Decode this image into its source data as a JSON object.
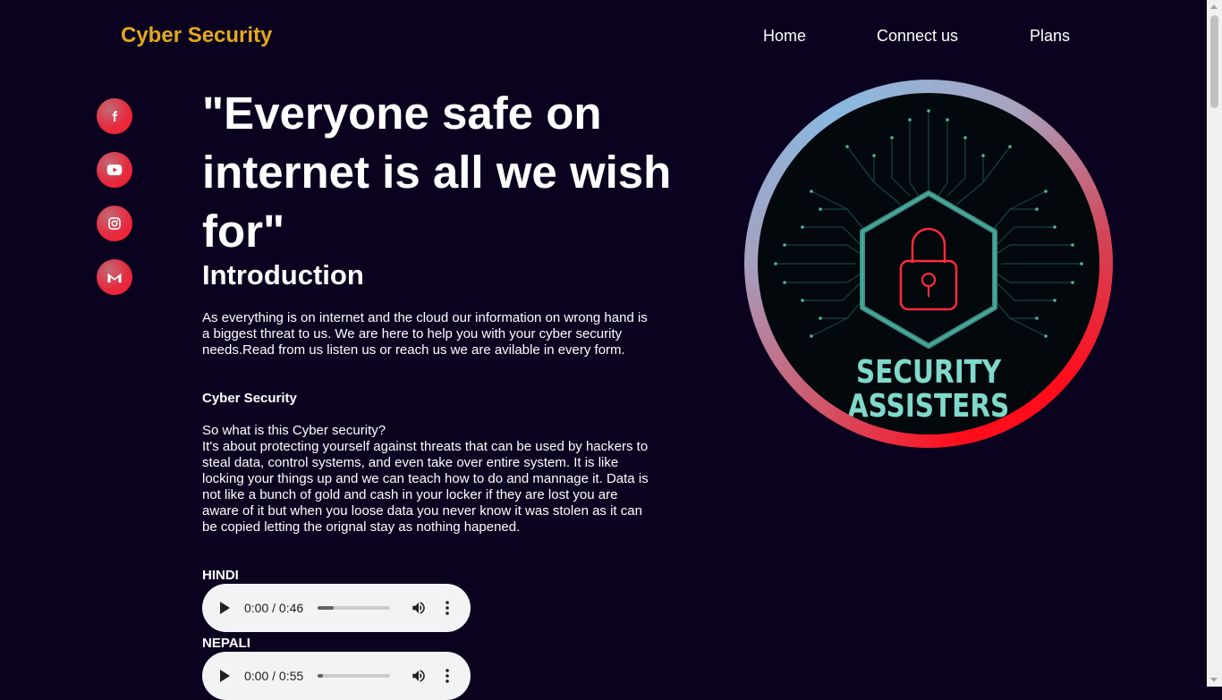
{
  "header": {
    "brand": "Cyber Security",
    "nav": [
      "Home",
      "Connect us",
      "Plans"
    ]
  },
  "social": [
    {
      "icon": "facebook-icon"
    },
    {
      "icon": "youtube-icon"
    },
    {
      "icon": "instagram-icon"
    },
    {
      "icon": "gmail-icon"
    }
  ],
  "hero": {
    "headline": "\"Everyone safe on internet is all we wish for\""
  },
  "intro": {
    "title": "Introduction",
    "paragraph": "As everything is on internet and the cloud our information on wrong hand is a biggest threat to us. We are here to help you with your cyber security needs.Read from us listen us or reach us we are avilable in every form.",
    "subheading": "Cyber Security",
    "question": "So what is this Cyber security?",
    "body": "It's about protecting yourself against threats that can be used by hackers to steal data, control systems, and even take over entire system. It is like locking your things up and we can teach how to do and mannage it. Data is not like a bunch of gold and cash in your locker if they are lost you are aware of it but when you loose data you never know it was stolen as it can be copied letting the orignal stay as nothing hapened."
  },
  "audio": [
    {
      "language": "HINDI",
      "time": "0:00 / 0:46",
      "progress": 0.22
    },
    {
      "language": "NEPALI",
      "time": "0:00 / 0:55",
      "progress": 0.08
    }
  ],
  "logo": {
    "line1": "SECURITY",
    "line2": "ASSISTERS"
  },
  "colors": {
    "background": "#0b0220",
    "brand": "#e3a81f",
    "accent_red": "#ff0d1b",
    "logo_teal": "#7fd9cc"
  }
}
